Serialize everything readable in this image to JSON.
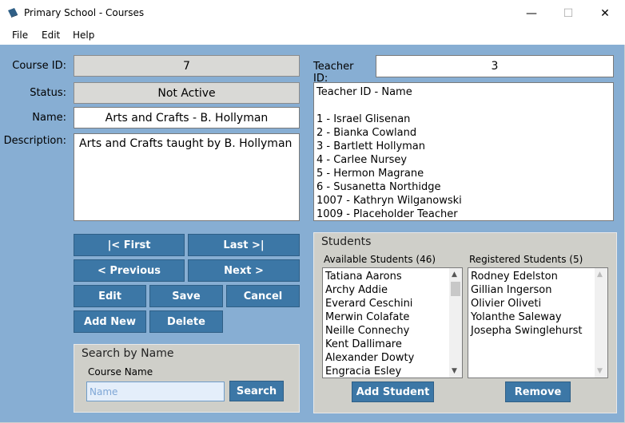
{
  "window": {
    "title": "Primary School - Courses",
    "minimize": "—",
    "maximize": "☐",
    "close": "✕"
  },
  "menu": {
    "file": "File",
    "edit": "Edit",
    "help": "Help"
  },
  "course": {
    "id_label": "Course ID:",
    "id_value": "7",
    "status_label": "Status:",
    "status_value": "Not Active",
    "name_label": "Name:",
    "name_value": "Arts and Crafts - B. Hollyman",
    "description_label": "Description:",
    "description_value": "Arts and Crafts taught by B. Hollyman"
  },
  "teacher": {
    "id_label": "Teacher ID:",
    "id_value": "3",
    "list": [
      "Teacher ID - Name",
      "",
      "1 - Israel Glisenan",
      "2 - Bianka Cowland",
      "3 - Bartlett Hollyman",
      "4 - Carlee Nursey",
      "5 - Hermon Magrane",
      "6 - Susanetta Northidge",
      "1007 - Kathryn Wilganowski",
      "1009 - Placeholder Teacher"
    ]
  },
  "nav": {
    "first": "|< First",
    "last": "Last >|",
    "previous": "< Previous",
    "next": "Next >",
    "edit": "Edit",
    "save": "Save",
    "cancel": "Cancel",
    "add_new": "Add New",
    "delete": "Delete"
  },
  "search": {
    "group_title": "Search by Name",
    "course_name_label": "Course Name",
    "placeholder": "Name",
    "button": "Search"
  },
  "students": {
    "group_title": "Students",
    "available_label": "Available Students (46)",
    "registered_label": "Registered Students (5)",
    "available": [
      "Tatiana Aarons",
      "Archy Addie",
      "Everard Ceschini",
      "Merwin Colafate",
      "Neille Connechy",
      "Kent Dallimare",
      "Alexander Dowty",
      "Engracia Esley"
    ],
    "registered": [
      "Rodney Edelston",
      "Gillian Ingerson",
      "Olivier Oliveti",
      "Yolanthe Saleway",
      "Josepha Swinglehurst"
    ],
    "add_button": "Add Student",
    "remove_button": "Remove"
  },
  "colors": {
    "background": "#87aed3",
    "button": "#3c77a6",
    "readonly": "#d9d9d6",
    "groupbox": "#cfcfc9"
  }
}
